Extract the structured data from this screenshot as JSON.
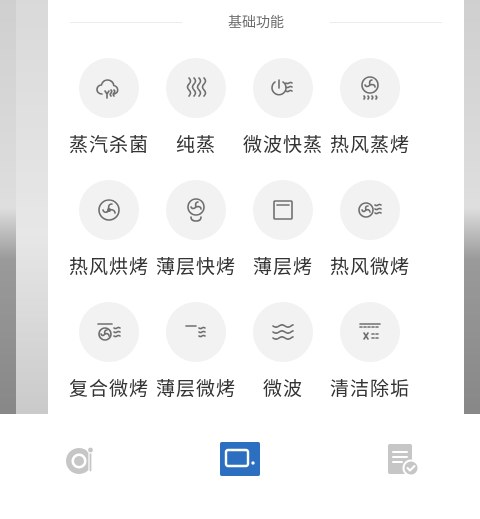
{
  "section": {
    "title": "基础功能"
  },
  "functions": [
    {
      "label": "蒸汽杀菌",
      "icon": "steam-sterilize-icon"
    },
    {
      "label": "纯蒸",
      "icon": "pure-steam-icon"
    },
    {
      "label": "微波快蒸",
      "icon": "microwave-quick-steam-icon"
    },
    {
      "label": "热风蒸烤",
      "icon": "hot-air-steam-bake-icon"
    },
    {
      "label": "热风烘烤",
      "icon": "hot-air-bake-icon"
    },
    {
      "label": "薄层快烤",
      "icon": "thin-layer-quick-bake-icon"
    },
    {
      "label": "薄层烤",
      "icon": "thin-layer-bake-icon"
    },
    {
      "label": "热风微烤",
      "icon": "hot-air-micro-bake-icon"
    },
    {
      "label": "复合微烤",
      "icon": "combo-micro-bake-icon"
    },
    {
      "label": "薄层微烤",
      "icon": "thin-layer-micro-bake-icon"
    },
    {
      "label": "微波",
      "icon": "microwave-icon"
    },
    {
      "label": "清洁除垢",
      "icon": "clean-descale-icon"
    }
  ],
  "bottom_nav": [
    {
      "name": "recipes",
      "icon": "recipe-pot-icon",
      "active": false
    },
    {
      "name": "device",
      "icon": "oven-device-icon",
      "active": true
    },
    {
      "name": "records",
      "icon": "document-check-icon",
      "active": false
    }
  ],
  "colors": {
    "icon_stroke": "#6e6e6e",
    "circle_bg": "#f2f2f2",
    "label_text": "#333333",
    "nav_active": "#2c6fc1",
    "nav_inactive": "#c6c6c6"
  }
}
